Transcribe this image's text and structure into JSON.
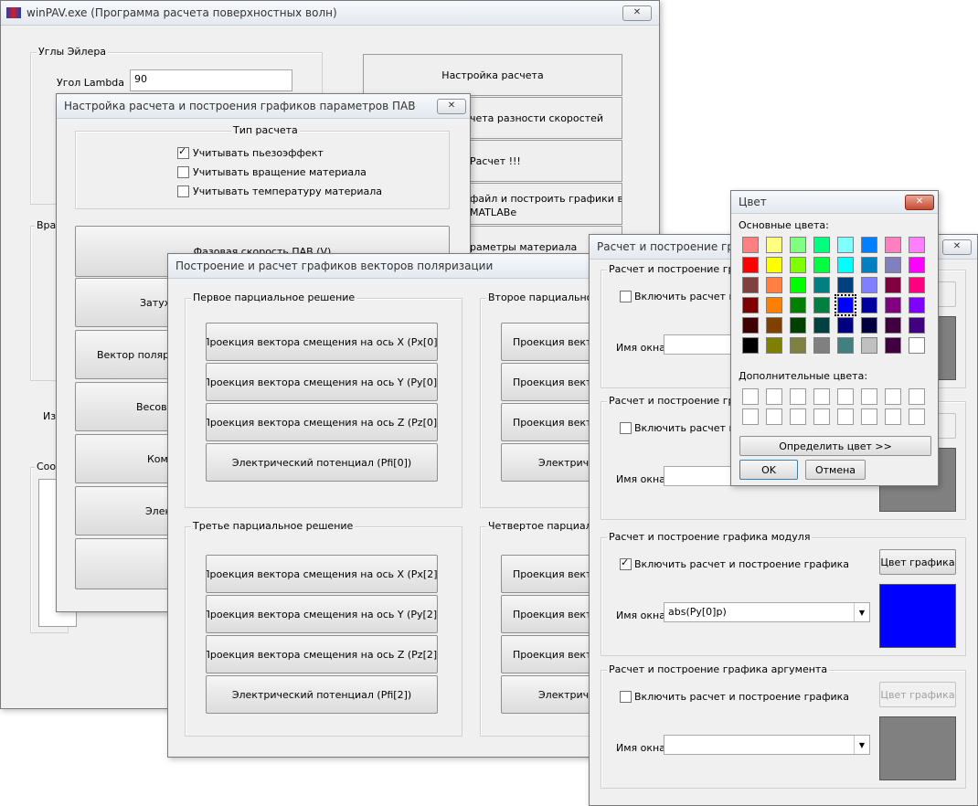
{
  "main": {
    "title": "winPAV.exe (Программа расчета поверхностных волн)",
    "close": "✕",
    "euler_group": "Углы Эйлера",
    "lambda_label": "Угол Lambda",
    "lambda_value": "90",
    "rotation_group": "Вращ",
    "partial_label": "Изм",
    "messages_group": "Сооб",
    "buttons": [
      "Настройка расчета",
      "чета разности скоростей",
      "Расчет !!!",
      "файл и построить графики в",
      "MATLABе",
      "раметры материала"
    ]
  },
  "settings": {
    "title": "Настройка расчета и построения графиков параметров ПАВ",
    "close": "✕",
    "calc_type": "Тип расчета",
    "options": [
      "Учитывать пьезоэффект",
      "Учитывать вращение материала",
      "Учитывать температуру материала"
    ],
    "buttons": [
      "Фазовая скорость ПАВ (V)",
      "Затух",
      "Вектор поляриз",
      "Весовы",
      "Комп",
      "Элек",
      ""
    ]
  },
  "polar": {
    "title": "Построение и расчет графиков векторов поляризации",
    "groups": [
      {
        "label": "Первое парциальное решение",
        "buttons": [
          "Проекция вектора смещения на ось X (Px[0])",
          "Проекция вектора смещения на ось Y (Py[0])",
          "Проекция вектора смещения на ось Z (Pz[0])",
          "Электрический потенциал (Pfi[0])"
        ]
      },
      {
        "label": "Второе парциальное р",
        "buttons": [
          "Проекция вектор",
          "Проекция вектор",
          "Проекция вектор",
          "Электрич"
        ]
      },
      {
        "label": "Третье парциальное решение",
        "buttons": [
          "Проекция вектора смещения на ось X (Px[2])",
          "Проекция вектора смещения на ось Y (Py[2])",
          "Проекция вектора смещения на ось Z (Pz[2])",
          "Электрический потенциал (Pfi[2])"
        ]
      },
      {
        "label": "Четвертое парциальн",
        "buttons": [
          "Проекция вектор",
          "Проекция вектор",
          "Проекция вектор",
          "Электрич"
        ]
      }
    ]
  },
  "graph": {
    "title": "Расчет и построение графи",
    "close": "✕",
    "sections": [
      {
        "label": "Расчет и построение графи",
        "check": "Включить расчет и",
        "window_label": "Имя окна",
        "window_value": "",
        "color_btn": "фика",
        "checked": false
      },
      {
        "label": "Расчет и построение графи",
        "check": "Включить расчет и",
        "window_label": "Имя окна",
        "window_value": "",
        "color_btn": "фика",
        "checked": false
      },
      {
        "label": "Расчет и построение графика модуля",
        "check": "Включить расчет и  построение графика",
        "window_label": "Имя окна",
        "window_value": "abs(Py[0]p)",
        "color_btn": "Цвет графика",
        "checked": true
      },
      {
        "label": "Расчет и построение графика аргумента",
        "check": "Включить расчет и  построение графика",
        "window_label": "Имя окна",
        "window_value": "",
        "color_btn": "Цвет графика",
        "checked": false
      }
    ],
    "swatch_colors": [
      "#808080",
      "#808080",
      "#0000ff",
      "#808080"
    ]
  },
  "color_dialog": {
    "title": "Цвет",
    "close": "✕",
    "basic_label": "Основные цвета:",
    "custom_label": "Дополнительные цвета:",
    "define_btn": "Определить цвет >>",
    "ok": "OK",
    "cancel": "Отмена",
    "basic_colors": [
      "#ff8080",
      "#ffff80",
      "#80ff80",
      "#00ff80",
      "#80ffff",
      "#0080ff",
      "#ff80c0",
      "#ff80ff",
      "#ff0000",
      "#ffff00",
      "#80ff00",
      "#00ff40",
      "#00ffff",
      "#0080c0",
      "#8080c0",
      "#ff00ff",
      "#804040",
      "#ff8040",
      "#00ff00",
      "#008080",
      "#004080",
      "#8080ff",
      "#800040",
      "#ff0080",
      "#800000",
      "#ff8000",
      "#008000",
      "#008040",
      "#0000ff",
      "#0000a0",
      "#800080",
      "#8000ff",
      "#400000",
      "#804000",
      "#004000",
      "#004040",
      "#000080",
      "#000040",
      "#400040",
      "#400080",
      "#000000",
      "#808000",
      "#808040",
      "#808080",
      "#408080",
      "#c0c0c0",
      "#400040",
      "#ffffff"
    ],
    "selected_index": 28
  }
}
